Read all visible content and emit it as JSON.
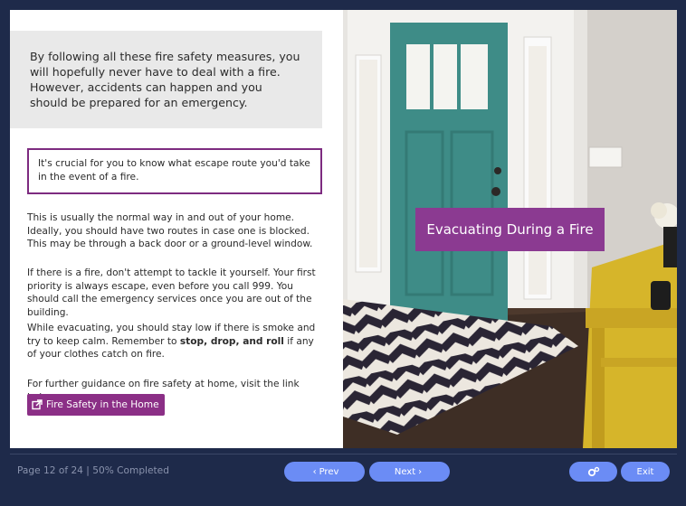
{
  "content": {
    "intro": "By following all these fire safety measures, you will hopefully never have to deal with a fire. However, accidents can happen and you should be prepared for an emergency.",
    "callout": "It's crucial for you to know what escape route you'd take in the event of a fire.",
    "p1": "This is usually the normal way in and out of your home. Ideally, you should have two routes in case one is blocked. This may be through a back door or a ground-level window.",
    "p2": "If there is a fire, don't attempt to tackle it yourself. Your first priority is always escape, even before you call 999. You should call the emergency services once you are out of the building.",
    "p3_before": "While evacuating, you should stay low if there is smoke and try to keep calm. Remember to ",
    "p3_bold": "stop, drop, and roll",
    "p3_after": " if any of your clothes catch on fire.",
    "p4": "For further guidance on fire safety at home, visit the link below:",
    "link_label": "Fire Safety in the Home"
  },
  "image": {
    "title": "Evacuating During a Fire"
  },
  "footer": {
    "page_info": "Page 12 of 24 | 50% Completed",
    "progress": 0.5,
    "prev_label": "Prev",
    "next_label": "Next",
    "exit_label": "Exit"
  },
  "colors": {
    "accent": "#8b3a91",
    "button": "#6b8cf5",
    "background": "#1e2a4a"
  }
}
